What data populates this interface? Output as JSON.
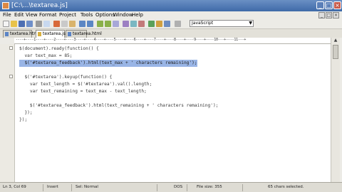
{
  "window": {
    "title": "[C:\\...\\textarea.js]"
  },
  "menu": [
    "File",
    "Edit",
    "View",
    "Format",
    "Project",
    "Tools",
    "Options",
    "Window",
    "Help"
  ],
  "toolbar": {
    "language": "JavaScript"
  },
  "tabs": [
    {
      "label": "textarea.html"
    },
    {
      "label": "textarea.js"
    },
    {
      "label": "textarea.html"
    }
  ],
  "ruler": [
    "----+----1----+----2----+----3----+----4----+----5----+----6----+----7----+----8----+----9----+----10---+----11---+"
  ],
  "code_lines": [
    "$(document).ready(function() {",
    "  var text_max = 85;",
    "  $('#textarea_feedback').html(text_max + ' characters remaining');",
    "",
    "  $('#textarea').keyup(function() {",
    "    var text_length = $('#textarea').val().length;",
    "    var text_remaining = text_max - text_length;",
    "",
    "    $('#textarea_feedback').html(text_remaining + ' characters remaining');",
    "  });",
    "});"
  ],
  "status": {
    "position": "Ln 3, Col 69",
    "mode": "Insert",
    "selection_mode": "Sel: Normal",
    "format": "DOS",
    "file_size": "File size: 355",
    "selected": "65 chars selected."
  }
}
